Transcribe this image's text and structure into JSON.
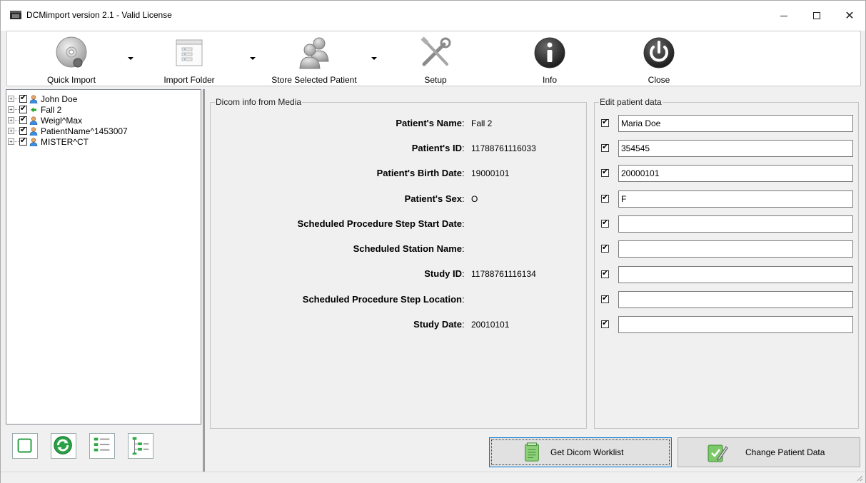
{
  "window": {
    "title": "DCMimport version 2.1 - Valid License",
    "controls": {
      "minimize": "–",
      "maximize": "☐",
      "close": "✕"
    }
  },
  "toolbar": {
    "items": [
      {
        "label": "Quick Import",
        "icon": "cd-disc-icon",
        "dropdown": true
      },
      {
        "label": "Import Folder",
        "icon": "folder-window-icon",
        "dropdown": true
      },
      {
        "label": "Store Selected Patient",
        "icon": "patients-icon",
        "dropdown": true
      },
      {
        "label": "Setup",
        "icon": "tools-icon",
        "dropdown": false
      },
      {
        "label": "Info",
        "icon": "info-icon",
        "dropdown": false
      },
      {
        "label": "Close",
        "icon": "power-icon",
        "dropdown": false
      }
    ]
  },
  "tree": {
    "items": [
      {
        "label": "John Doe",
        "checked": true,
        "icon": "person-icon"
      },
      {
        "label": "Fall 2",
        "checked": true,
        "icon": "green-arrow-icon"
      },
      {
        "label": "Weigl^Max",
        "checked": true,
        "icon": "person-icon"
      },
      {
        "label": "PatientName^1453007",
        "checked": true,
        "icon": "person-icon"
      },
      {
        "label": "MISTER^CT",
        "checked": true,
        "icon": "person-icon"
      }
    ]
  },
  "left_buttons": [
    "square-icon",
    "refresh-icon",
    "list-icon",
    "tree-list-icon"
  ],
  "dicom_info": {
    "title": "Dicom info from Media",
    "rows": [
      {
        "label": "Patient's Name",
        "value": "Fall 2"
      },
      {
        "label": "Patient's ID",
        "value": "11788761116033"
      },
      {
        "label": "Patient's Birth Date",
        "value": "19000101"
      },
      {
        "label": "Patient's Sex",
        "value": "O"
      },
      {
        "label": "Scheduled Procedure Step Start Date",
        "value": ""
      },
      {
        "label": "Scheduled Station Name",
        "value": ""
      },
      {
        "label": "Study ID",
        "value": "11788761116134"
      },
      {
        "label": "Scheduled Procedure Step Location",
        "value": ""
      },
      {
        "label": "Study Date",
        "value": "20010101"
      }
    ]
  },
  "edit_data": {
    "title": "Edit patient data",
    "fields": [
      {
        "checked": true,
        "value": "Maria Doe"
      },
      {
        "checked": true,
        "value": "354545"
      },
      {
        "checked": true,
        "value": "20000101"
      },
      {
        "checked": true,
        "value": "F"
      },
      {
        "checked": true,
        "value": ""
      },
      {
        "checked": true,
        "value": ""
      },
      {
        "checked": true,
        "value": ""
      },
      {
        "checked": true,
        "value": ""
      },
      {
        "checked": true,
        "value": ""
      }
    ]
  },
  "buttons": {
    "get_worklist": "Get Dicom Worklist",
    "change_patient": "Change Patient Data"
  },
  "colors": {
    "accent": "#0078d7",
    "tree_person": "#3d8ee0",
    "tree_arrow": "#2aa52a",
    "green_button": "#27a244"
  }
}
